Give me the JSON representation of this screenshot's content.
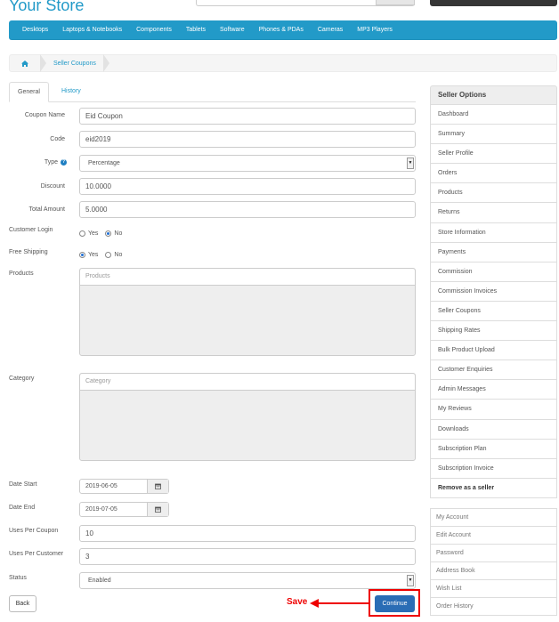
{
  "store_title": "Your Store",
  "menu": [
    "Desktops",
    "Laptops & Notebooks",
    "Components",
    "Tablets",
    "Software",
    "Phones & PDAs",
    "Cameras",
    "MP3 Players"
  ],
  "breadcrumb": {
    "home_icon": "home-icon",
    "current": "Seller Coupons"
  },
  "tabs": {
    "general": "General",
    "history": "History"
  },
  "form": {
    "coupon_name": {
      "label": "Coupon Name",
      "value": "Eid Coupon"
    },
    "code": {
      "label": "Code",
      "value": "eid2019"
    },
    "type": {
      "label": "Type",
      "value": "Percentage"
    },
    "discount": {
      "label": "Discount",
      "value": "10.0000"
    },
    "total_amount": {
      "label": "Total Amount",
      "value": "5.0000"
    },
    "customer_login": {
      "label": "Customer Login",
      "yes": "Yes",
      "no": "No",
      "selected": "No"
    },
    "free_shipping": {
      "label": "Free Shipping",
      "yes": "Yes",
      "no": "No",
      "selected": "Yes"
    },
    "products": {
      "label": "Products",
      "placeholder": "Products"
    },
    "category": {
      "label": "Category",
      "placeholder": "Category"
    },
    "date_start": {
      "label": "Date Start",
      "value": "2019-06-05"
    },
    "date_end": {
      "label": "Date End",
      "value": "2019-07-05"
    },
    "uses_per_coupon": {
      "label": "Uses Per Coupon",
      "value": "10"
    },
    "uses_per_customer": {
      "label": "Uses Per Customer",
      "value": "3"
    },
    "status": {
      "label": "Status",
      "value": "Enabled"
    }
  },
  "buttons": {
    "back": "Back",
    "continue": "Continue"
  },
  "annotation": {
    "text": "Save",
    "color": "#e00000"
  },
  "sidebar": {
    "title": "Seller Options",
    "items": [
      "Dashboard",
      "Summary",
      "Seller Profile",
      "Orders",
      "Products",
      "Returns",
      "Store Information",
      "Payments",
      "Commission",
      "Commission Invoices",
      "Seller Coupons",
      "Shipping Rates",
      "Bulk Product Upload",
      "Customer Enquiries",
      "Admin Messages",
      "My Reviews",
      "Downloads",
      "Subscription Plan",
      "Subscription Invoice",
      "Remove as a seller"
    ]
  },
  "account_list": [
    "My Account",
    "Edit Account",
    "Password",
    "Address Book",
    "Wish List",
    "Order History"
  ],
  "colors": {
    "brand": "#229ac8",
    "primary_button": "#2a6db5"
  }
}
